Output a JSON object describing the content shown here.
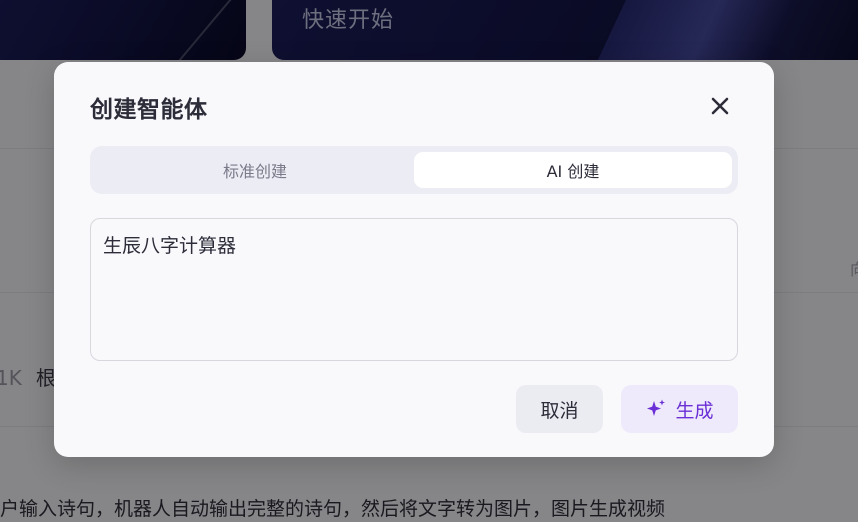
{
  "background": {
    "card_title": "快速开始",
    "left_stat": "1K",
    "left_word": "根",
    "edge_glyph": "向",
    "description": "户输入诗句，机器人自动输出完整的诗句，然后将文字转为图片，图片生成视频"
  },
  "dialog": {
    "title": "创建智能体",
    "close_icon": "close-icon",
    "tabs": [
      {
        "label": "标准创建",
        "active": false
      },
      {
        "label": "AI 创建",
        "active": true
      }
    ],
    "prompt_value": "生辰八字计算器",
    "cancel_label": "取消",
    "generate_label": "生成",
    "generate_icon": "sparkle-icon",
    "accent_color": "#6a2fd6"
  }
}
